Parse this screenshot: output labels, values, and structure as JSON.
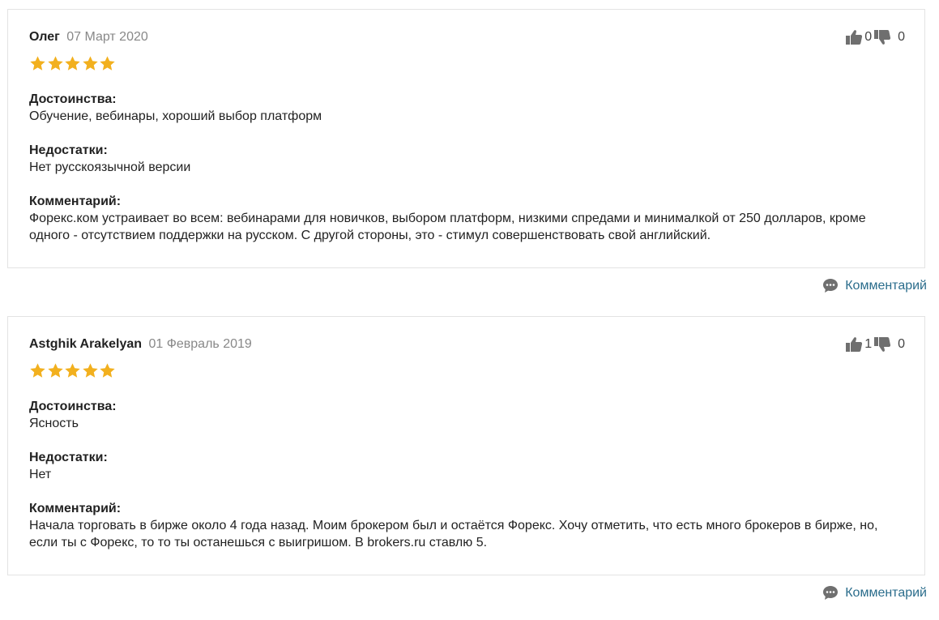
{
  "reviews": [
    {
      "author": "Олег",
      "date": "07 Март 2020",
      "rating": 5,
      "likes": "0",
      "dislikes": "0",
      "pros_label": "Достоинства:",
      "pros": "Обучение, вебинары, хороший выбор платформ",
      "cons_label": "Недостатки:",
      "cons": "Нет русскоязычной версии",
      "comment_label": "Комментарий:",
      "comment_line1": "Форекс.ком устраивает во всем: вебинарами для новичков, выбором платформ, низкими спредами и минималкой от 250 долларов, кроме",
      "comment_line2": "одного - отсутствием поддержки на русском. С другой стороны, это - стимул совершенствовать свой английский.",
      "reply_label": "Комментарий"
    },
    {
      "author": "Astghik Arakelyan",
      "date": "01 Февраль 2019",
      "rating": 5,
      "likes": "1",
      "dislikes": "0",
      "pros_label": "Достоинства:",
      "pros": "Ясность",
      "cons_label": "Недостатки:",
      "cons": "Нет",
      "comment_label": "Комментарий:",
      "comment_line1": "Начала торговать в бирже около 4 года назад. Моим брокером был и остаётся Форекс. Хочу отметить, что есть много брокеров в бирже, но,",
      "comment_line2": "если ты с Форекс, то то ты останешься с выигришом. В brokers.ru ставлю 5.",
      "reply_label": "Комментарий"
    }
  ],
  "colors": {
    "star": "#f2b01e",
    "link": "#2b6d8c",
    "icon": "#6f6f6f",
    "date": "#888888",
    "border": "#e3e3e3"
  },
  "icons": {
    "like": "thumbs-up-icon",
    "dislike": "thumbs-down-icon",
    "reply": "comment-bubble-icon",
    "star": "star-icon"
  }
}
